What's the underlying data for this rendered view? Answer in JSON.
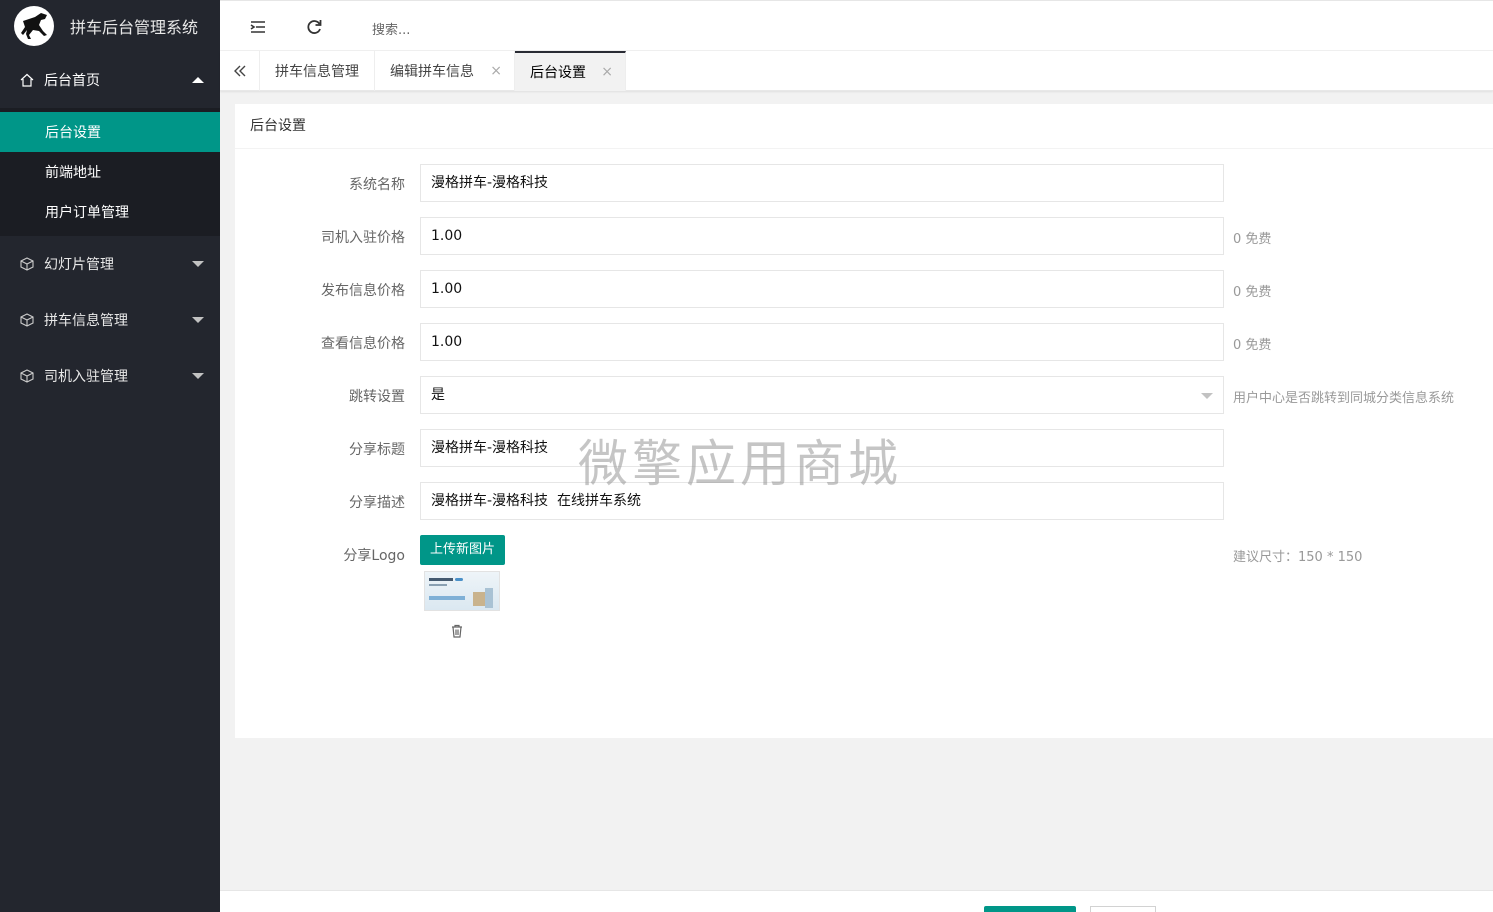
{
  "app": {
    "title": "拼车后台管理系统"
  },
  "sidebar": {
    "groups": [
      {
        "label": "后台首页",
        "icon": "home-icon",
        "expanded": true,
        "items": [
          {
            "label": "后台设置",
            "active": true
          },
          {
            "label": "前端地址",
            "active": false
          },
          {
            "label": "用户订单管理",
            "active": false
          }
        ]
      },
      {
        "label": "幻灯片管理",
        "icon": "cube-icon",
        "expanded": false
      },
      {
        "label": "拼车信息管理",
        "icon": "cube-icon",
        "expanded": false
      },
      {
        "label": "司机入驻管理",
        "icon": "cube-icon",
        "expanded": false
      }
    ]
  },
  "topbar": {
    "search_placeholder": "搜索..."
  },
  "tabs": [
    {
      "label": "拼车信息管理",
      "closable": false,
      "active": false
    },
    {
      "label": "编辑拼车信息",
      "closable": true,
      "active": false
    },
    {
      "label": "后台设置",
      "closable": true,
      "active": true
    }
  ],
  "tab_close_glyph": "×",
  "card": {
    "title": "后台设置",
    "fields": [
      {
        "label": "系统名称",
        "value": "漫格拼车-漫格科技",
        "hint": ""
      },
      {
        "label": "司机入驻价格",
        "value": "1.00",
        "hint": "0 免费"
      },
      {
        "label": "发布信息价格",
        "value": "1.00",
        "hint": "0 免费"
      },
      {
        "label": "查看信息价格",
        "value": "1.00",
        "hint": "0 免费"
      },
      {
        "label": "跳转设置",
        "value": "是",
        "hint": "用户中心是否跳转到同城分类信息系统",
        "type": "select"
      },
      {
        "label": "分享标题",
        "value": "漫格拼车-漫格科技",
        "hint": ""
      },
      {
        "label": "分享描述",
        "value": "漫格拼车-漫格科技  在线拼车系统",
        "hint": ""
      }
    ],
    "logo": {
      "label": "分享Logo",
      "button": "上传新图片",
      "hint": "建议尺寸：150 * 150"
    }
  },
  "watermark": "微擎应用商城",
  "colors": {
    "sidebar_bg": "#23262e",
    "accent": "#009688",
    "sub_bg": "#1b1d23"
  }
}
